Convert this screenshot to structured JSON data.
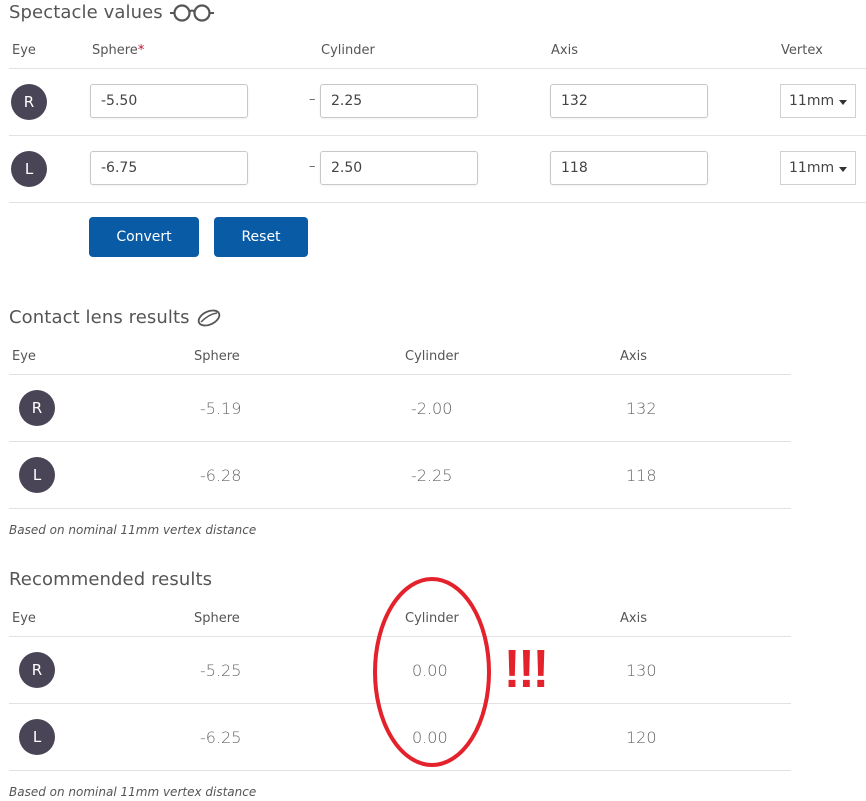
{
  "spectacle": {
    "title": "Spectacle values",
    "title_icon": "glasses-icon",
    "headers": {
      "eye": "Eye",
      "sphere": "Sphere",
      "required_mark": "*",
      "cylinder": "Cylinder",
      "axis": "Axis",
      "vertex": "Vertex"
    },
    "rows": [
      {
        "eye": "R",
        "sphere": "-5.50",
        "cyl_sign": "–",
        "cylinder": "2.25",
        "axis": "132",
        "vertex": "11mm"
      },
      {
        "eye": "L",
        "sphere": "-6.75",
        "cyl_sign": "–",
        "cylinder": "2.50",
        "axis": "118",
        "vertex": "11mm"
      }
    ],
    "buttons": {
      "convert": "Convert",
      "reset": "Reset"
    }
  },
  "contact": {
    "title": "Contact lens results",
    "title_icon": "contact-lens-icon",
    "headers": {
      "eye": "Eye",
      "sphere": "Sphere",
      "cylinder": "Cylinder",
      "axis": "Axis"
    },
    "rows": [
      {
        "eye": "R",
        "sphere": "-5.19",
        "cylinder": "-2.00",
        "axis": "132"
      },
      {
        "eye": "L",
        "sphere": "-6.28",
        "cylinder": "-2.25",
        "axis": "118"
      }
    ],
    "note": "Based on nominal 11mm vertex distance"
  },
  "recommended": {
    "title": "Recommended results",
    "headers": {
      "eye": "Eye",
      "sphere": "Sphere",
      "cylinder": "Cylinder",
      "axis": "Axis"
    },
    "rows": [
      {
        "eye": "R",
        "sphere": "-5.25",
        "cylinder": "0.00",
        "axis": "130"
      },
      {
        "eye": "L",
        "sphere": "-6.25",
        "cylinder": "0.00",
        "axis": "120"
      }
    ],
    "note": "Based on nominal 11mm vertex distance"
  },
  "annotation": {
    "text": "!!!",
    "color": "#e3222b"
  },
  "colors": {
    "button": "#0a5ba6",
    "avatar": "#4a4556",
    "required": "#c8102e"
  }
}
